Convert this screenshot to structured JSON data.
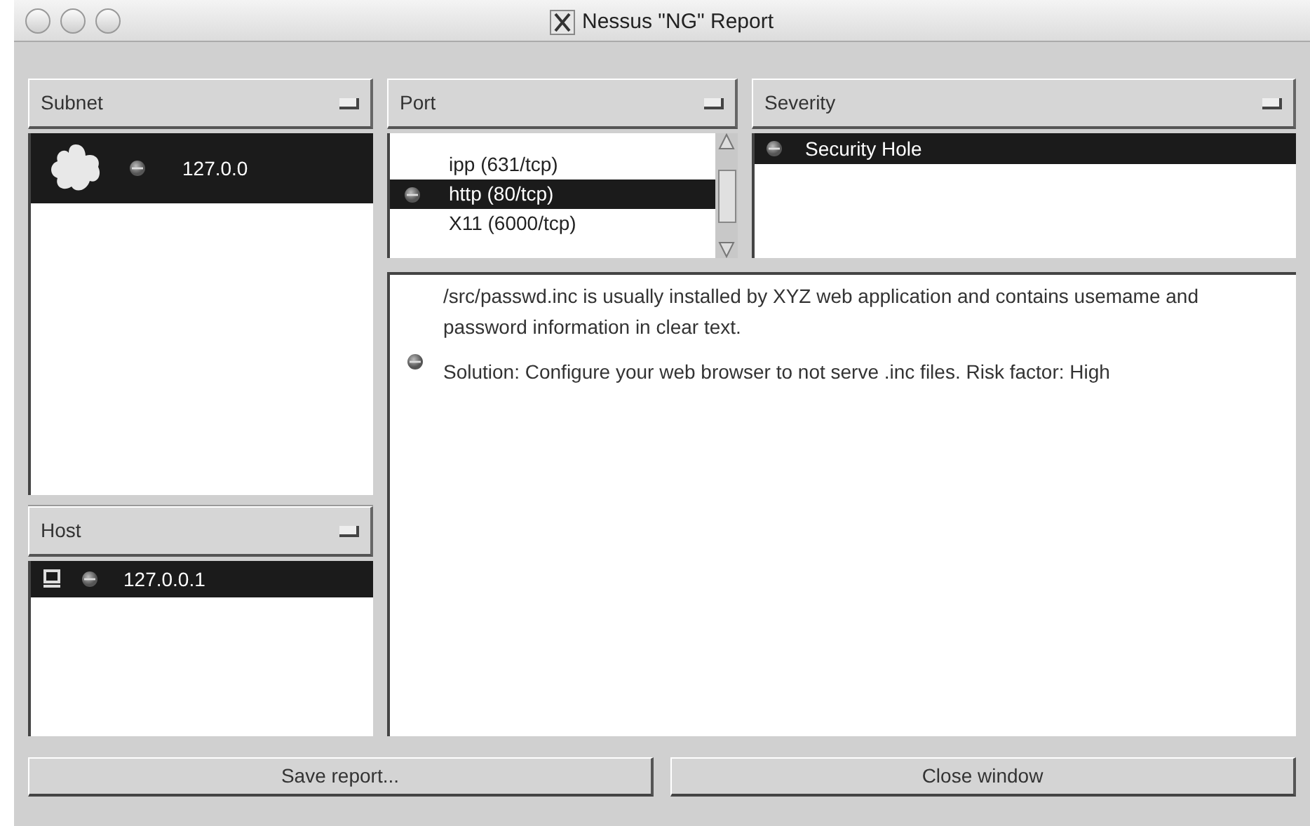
{
  "window": {
    "title": "Nessus \"NG\" Report"
  },
  "subnet": {
    "header": "Subnet",
    "items": [
      {
        "label": "127.0.0",
        "selected": true
      }
    ]
  },
  "host": {
    "header": "Host",
    "items": [
      {
        "label": "127.0.0.1",
        "selected": true
      }
    ]
  },
  "port": {
    "header": "Port",
    "items": [
      {
        "label": "ipp (631/tcp)",
        "selected": false,
        "marked": false
      },
      {
        "label": "http (80/tcp)",
        "selected": true,
        "marked": true
      },
      {
        "label": "X11 (6000/tcp)",
        "selected": false,
        "marked": false
      }
    ]
  },
  "severity": {
    "header": "Severity",
    "items": [
      {
        "label": "Security Hole",
        "selected": true
      }
    ]
  },
  "details": {
    "description": "/src/passwd.inc is usually installed by XYZ web application and contains usemame and password information in clear text.",
    "solution": "Solution: Configure your web browser to not serve .inc files. Risk factor: High"
  },
  "buttons": [
    "Save report...",
    "Close window"
  ]
}
